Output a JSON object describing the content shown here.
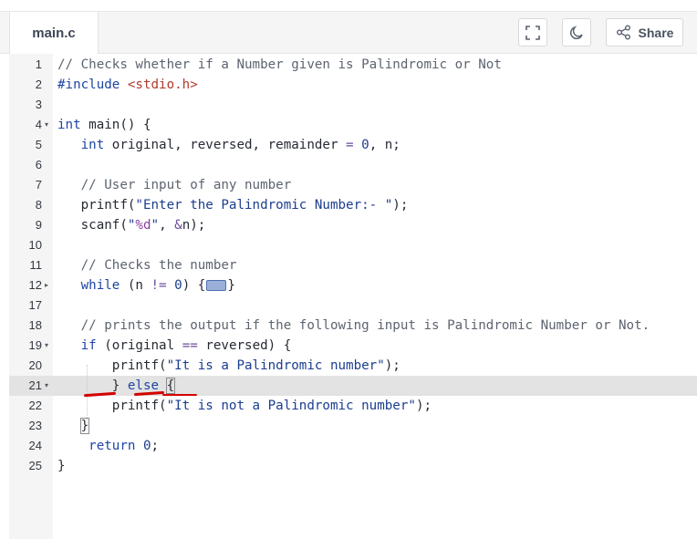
{
  "header": {
    "file_tab": "main.c",
    "share_label": "Share",
    "icons": [
      "fullscreen-icon",
      "dark-mode-moon-icon",
      "share-icon"
    ]
  },
  "editor": {
    "active_line": "21",
    "lines": [
      {
        "n": "1",
        "fold": "",
        "tokens": [
          {
            "t": "// Checks whether if a Number given is Palindromic or Not",
            "c": "cm"
          }
        ]
      },
      {
        "n": "2",
        "fold": "",
        "tokens": [
          {
            "t": "#include ",
            "c": "pp"
          },
          {
            "t": "<stdio.h>",
            "c": "inc"
          }
        ]
      },
      {
        "n": "3",
        "fold": "",
        "tokens": []
      },
      {
        "n": "4",
        "fold": "down",
        "tokens": [
          {
            "t": "int",
            "c": "kw"
          },
          {
            "t": " main() {",
            "c": ""
          }
        ]
      },
      {
        "n": "5",
        "fold": "",
        "tokens": [
          {
            "t": "   ",
            "c": ""
          },
          {
            "t": "int",
            "c": "kw"
          },
          {
            "t": " original, reversed, remainder ",
            "c": ""
          },
          {
            "t": "=",
            "c": "op"
          },
          {
            "t": " ",
            "c": ""
          },
          {
            "t": "0",
            "c": "num"
          },
          {
            "t": ", n;",
            "c": ""
          }
        ]
      },
      {
        "n": "6",
        "fold": "",
        "tokens": []
      },
      {
        "n": "7",
        "fold": "",
        "tokens": [
          {
            "t": "   ",
            "c": ""
          },
          {
            "t": "// User input of any number",
            "c": "cm"
          }
        ]
      },
      {
        "n": "8",
        "fold": "",
        "tokens": [
          {
            "t": "   printf(",
            "c": ""
          },
          {
            "t": "\"Enter the Palindromic Number:- \"",
            "c": "str"
          },
          {
            "t": ");",
            "c": ""
          }
        ]
      },
      {
        "n": "9",
        "fold": "",
        "tokens": [
          {
            "t": "   scanf(",
            "c": ""
          },
          {
            "t": "\"",
            "c": "str"
          },
          {
            "t": "%d",
            "c": "esc"
          },
          {
            "t": "\"",
            "c": "str"
          },
          {
            "t": ", ",
            "c": ""
          },
          {
            "t": "&",
            "c": "op"
          },
          {
            "t": "n);",
            "c": ""
          }
        ]
      },
      {
        "n": "10",
        "fold": "",
        "tokens": []
      },
      {
        "n": "11",
        "fold": "",
        "tokens": [
          {
            "t": "   ",
            "c": ""
          },
          {
            "t": "// Checks the number",
            "c": "cm"
          }
        ]
      },
      {
        "n": "12",
        "fold": "right",
        "tokens": [
          {
            "t": "   ",
            "c": ""
          },
          {
            "t": "while",
            "c": "kw"
          },
          {
            "t": " (n ",
            "c": ""
          },
          {
            "t": "!=",
            "c": "op"
          },
          {
            "t": " ",
            "c": ""
          },
          {
            "t": "0",
            "c": "num"
          },
          {
            "t": ") {",
            "c": ""
          },
          {
            "t": "",
            "c": "foldwidget"
          },
          {
            "t": "}",
            "c": ""
          }
        ]
      },
      {
        "n": "17",
        "fold": "",
        "tokens": []
      },
      {
        "n": "18",
        "fold": "",
        "tokens": [
          {
            "t": "   ",
            "c": ""
          },
          {
            "t": "// prints the output if the following input is Palindromic Number or Not.",
            "c": "cm"
          }
        ]
      },
      {
        "n": "19",
        "fold": "down",
        "tokens": [
          {
            "t": "   ",
            "c": ""
          },
          {
            "t": "if",
            "c": "kw"
          },
          {
            "t": " (original ",
            "c": ""
          },
          {
            "t": "==",
            "c": "op"
          },
          {
            "t": " reversed) {",
            "c": ""
          }
        ]
      },
      {
        "n": "20",
        "fold": "",
        "tokens": [
          {
            "t": "       printf(",
            "c": ""
          },
          {
            "t": "\"It is a Palindromic number\"",
            "c": "str"
          },
          {
            "t": ");",
            "c": ""
          }
        ]
      },
      {
        "n": "21",
        "fold": "down",
        "tokens": [
          {
            "t": "       } ",
            "c": ""
          },
          {
            "t": "else",
            "c": "kw"
          },
          {
            "t": " ",
            "c": ""
          },
          {
            "t": "{",
            "c": "box"
          }
        ]
      },
      {
        "n": "22",
        "fold": "",
        "tokens": [
          {
            "t": "       printf(",
            "c": ""
          },
          {
            "t": "\"It is not a Palindromic number\"",
            "c": "str"
          },
          {
            "t": ");",
            "c": ""
          }
        ]
      },
      {
        "n": "23",
        "fold": "",
        "tokens": [
          {
            "t": "   ",
            "c": ""
          },
          {
            "t": "}",
            "c": "box"
          }
        ]
      },
      {
        "n": "24",
        "fold": "",
        "tokens": [
          {
            "t": "    ",
            "c": ""
          },
          {
            "t": "return",
            "c": "kw"
          },
          {
            "t": " ",
            "c": ""
          },
          {
            "t": "0",
            "c": "num"
          },
          {
            "t": ";",
            "c": ""
          }
        ]
      },
      {
        "n": "25",
        "fold": "",
        "tokens": [
          {
            "t": "}",
            "c": ""
          }
        ]
      }
    ]
  }
}
